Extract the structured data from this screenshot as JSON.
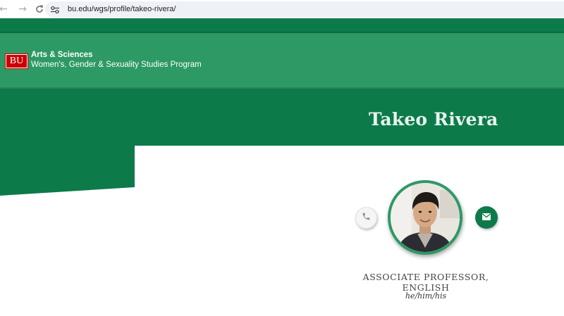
{
  "browser": {
    "url": "bu.edu/wgs/profile/takeo-rivera/",
    "icons": [
      "back-arrow-icon",
      "forward-arrow-icon",
      "reload-icon",
      "site-info-icon"
    ]
  },
  "header": {
    "logo_text": "BU",
    "college": "Arts & Sciences",
    "program": "Women's, Gender & Sexuality Studies Program"
  },
  "profile": {
    "name": "Takeo Rivera",
    "title": "ASSOCIATE PROFESSOR, ENGLISH",
    "pronouns": "he/him/his",
    "contact_icons": [
      "phone-icon",
      "email-icon"
    ]
  },
  "colors": {
    "dark_green": "#0d7a4a",
    "header_green": "#2d9965",
    "bu_red": "#cc0000",
    "white": "#ffffff"
  }
}
